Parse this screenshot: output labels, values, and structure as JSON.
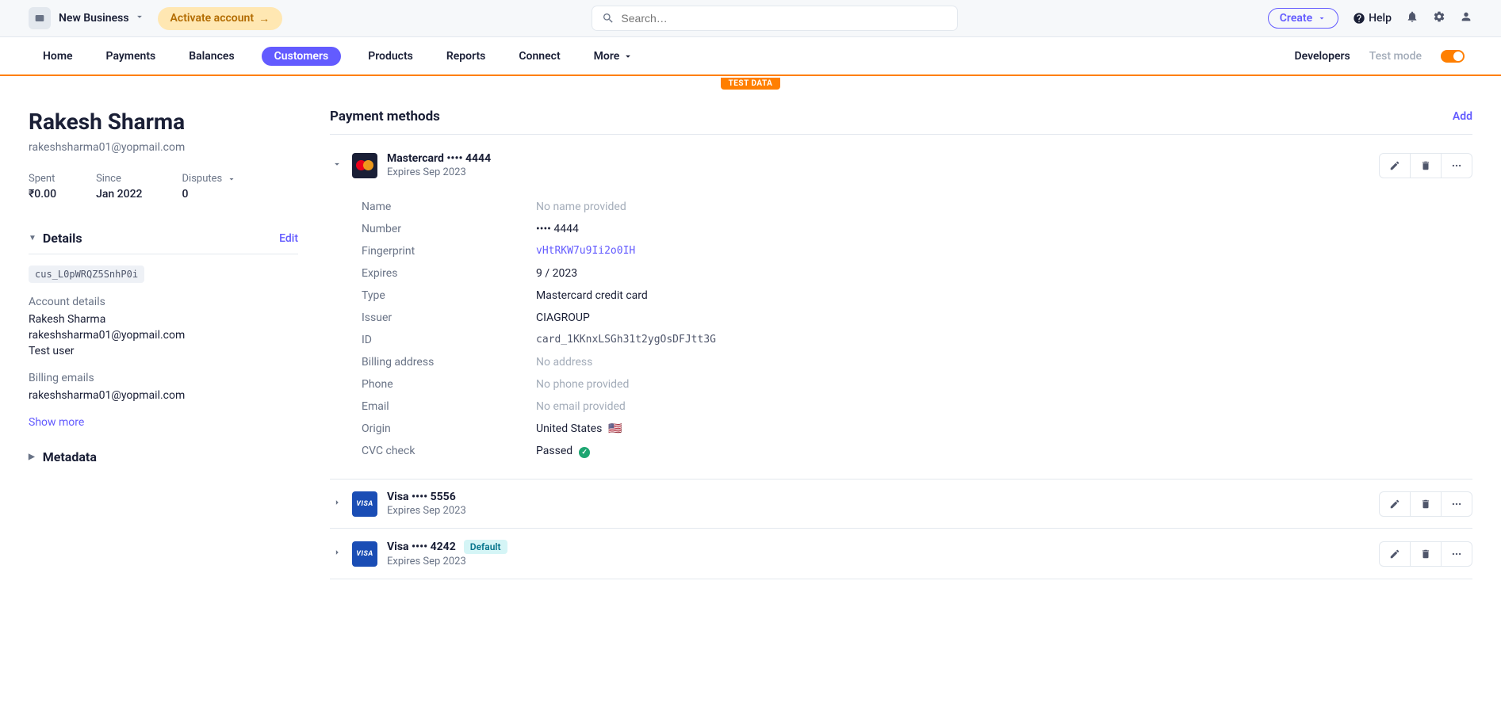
{
  "topbar": {
    "business_name": "New Business",
    "activate_label": "Activate account",
    "search_placeholder": "Search…",
    "create_label": "Create",
    "help_label": "Help"
  },
  "nav": {
    "items": [
      "Home",
      "Payments",
      "Balances",
      "Customers",
      "Products",
      "Reports",
      "Connect",
      "More"
    ],
    "developers_label": "Developers",
    "testmode_label": "Test mode"
  },
  "test_badge": "TEST DATA",
  "customer": {
    "name": "Rakesh Sharma",
    "email": "rakeshsharma01@yopmail.com",
    "id": "cus_L0pWRQZ5SnhP0i",
    "stats": {
      "spent_label": "Spent",
      "spent_value": "₹0.00",
      "since_label": "Since",
      "since_value": "Jan 2022",
      "disputes_label": "Disputes",
      "disputes_value": "0"
    },
    "details_title": "Details",
    "edit_label": "Edit",
    "account_details_label": "Account details",
    "account_name": "Rakesh Sharma",
    "account_email": "rakeshsharma01@yopmail.com",
    "account_desc": "Test user",
    "billing_emails_label": "Billing emails",
    "billing_email": "rakeshsharma01@yopmail.com",
    "show_more": "Show more",
    "metadata_title": "Metadata"
  },
  "main": {
    "title": "Payment methods",
    "add_label": "Add"
  },
  "pm_expanded": {
    "title": "Mastercard •••• 4444",
    "expires": "Expires Sep 2023",
    "fields": {
      "name_label": "Name",
      "name_value": "No name provided",
      "number_label": "Number",
      "number_value": "•••• 4444",
      "fingerprint_label": "Fingerprint",
      "fingerprint_value": "vHtRKW7u9Ii2o0IH",
      "expires_label": "Expires",
      "expires_value": "9 / 2023",
      "type_label": "Type",
      "type_value": "Mastercard credit card",
      "issuer_label": "Issuer",
      "issuer_value": "CIAGROUP",
      "id_label": "ID",
      "id_value": "card_1KKnxLSGh31t2ygOsDFJtt3G",
      "billing_label": "Billing address",
      "billing_value": "No address",
      "phone_label": "Phone",
      "phone_value": "No phone provided",
      "email_label": "Email",
      "email_value": "No email provided",
      "origin_label": "Origin",
      "origin_value": "United States",
      "cvc_label": "CVC check",
      "cvc_value": "Passed"
    }
  },
  "pm_others": [
    {
      "title": "Visa •••• 5556",
      "expires": "Expires Sep 2023",
      "default": false
    },
    {
      "title": "Visa •••• 4242",
      "expires": "Expires Sep 2023",
      "default": true,
      "default_label": "Default"
    }
  ]
}
